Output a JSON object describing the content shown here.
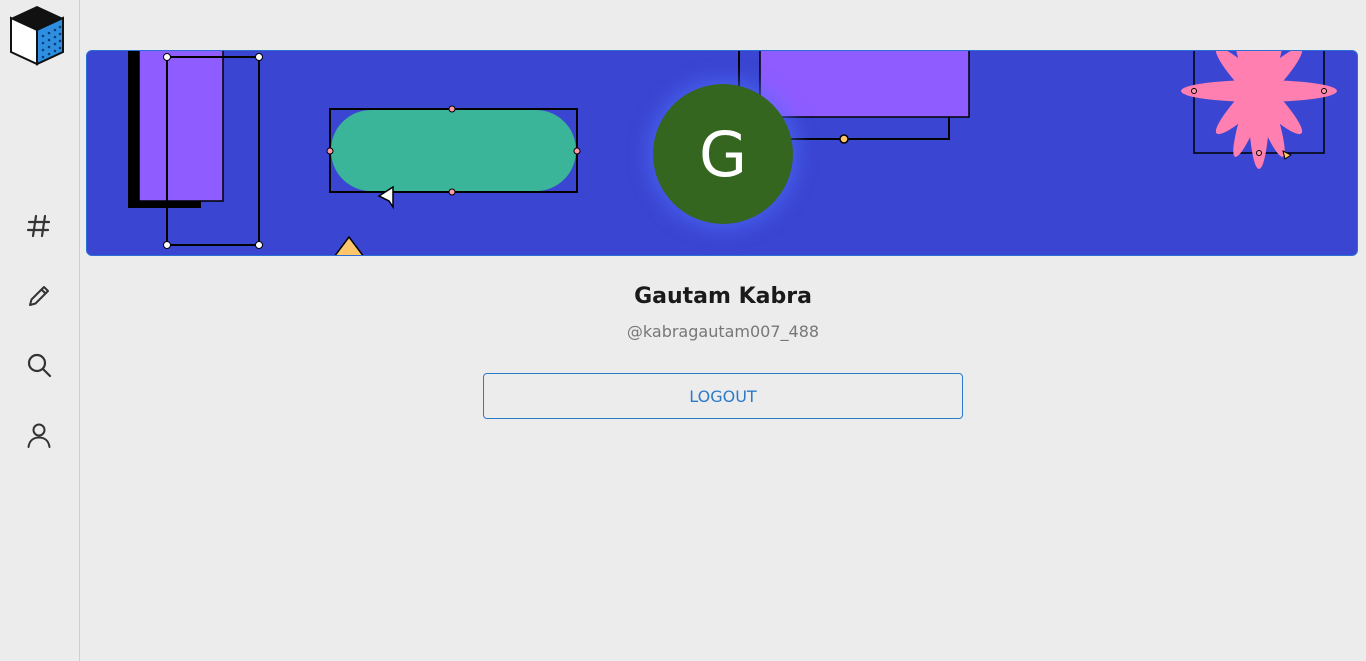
{
  "sidebar": {
    "logo_icon": "cube-logo-icon",
    "items": [
      {
        "icon": "hashtag-icon",
        "name": "nav-hashtag"
      },
      {
        "icon": "pencil-icon",
        "name": "nav-write"
      },
      {
        "icon": "search-icon",
        "name": "nav-search"
      },
      {
        "icon": "user-icon",
        "name": "nav-profile"
      }
    ]
  },
  "profile": {
    "avatar_initial": "G",
    "name": "Gautam Kabra",
    "handle": "@kabragautam007_488",
    "logout_label": "LOGOUT"
  },
  "colors": {
    "banner_bg": "#3a46d1",
    "avatar_bg": "#34661f",
    "accent": "#2b7bc9",
    "purple": "#8f5cff",
    "teal": "#3ab599",
    "pink": "#ff7fb0",
    "yellow": "#ffc66b"
  }
}
